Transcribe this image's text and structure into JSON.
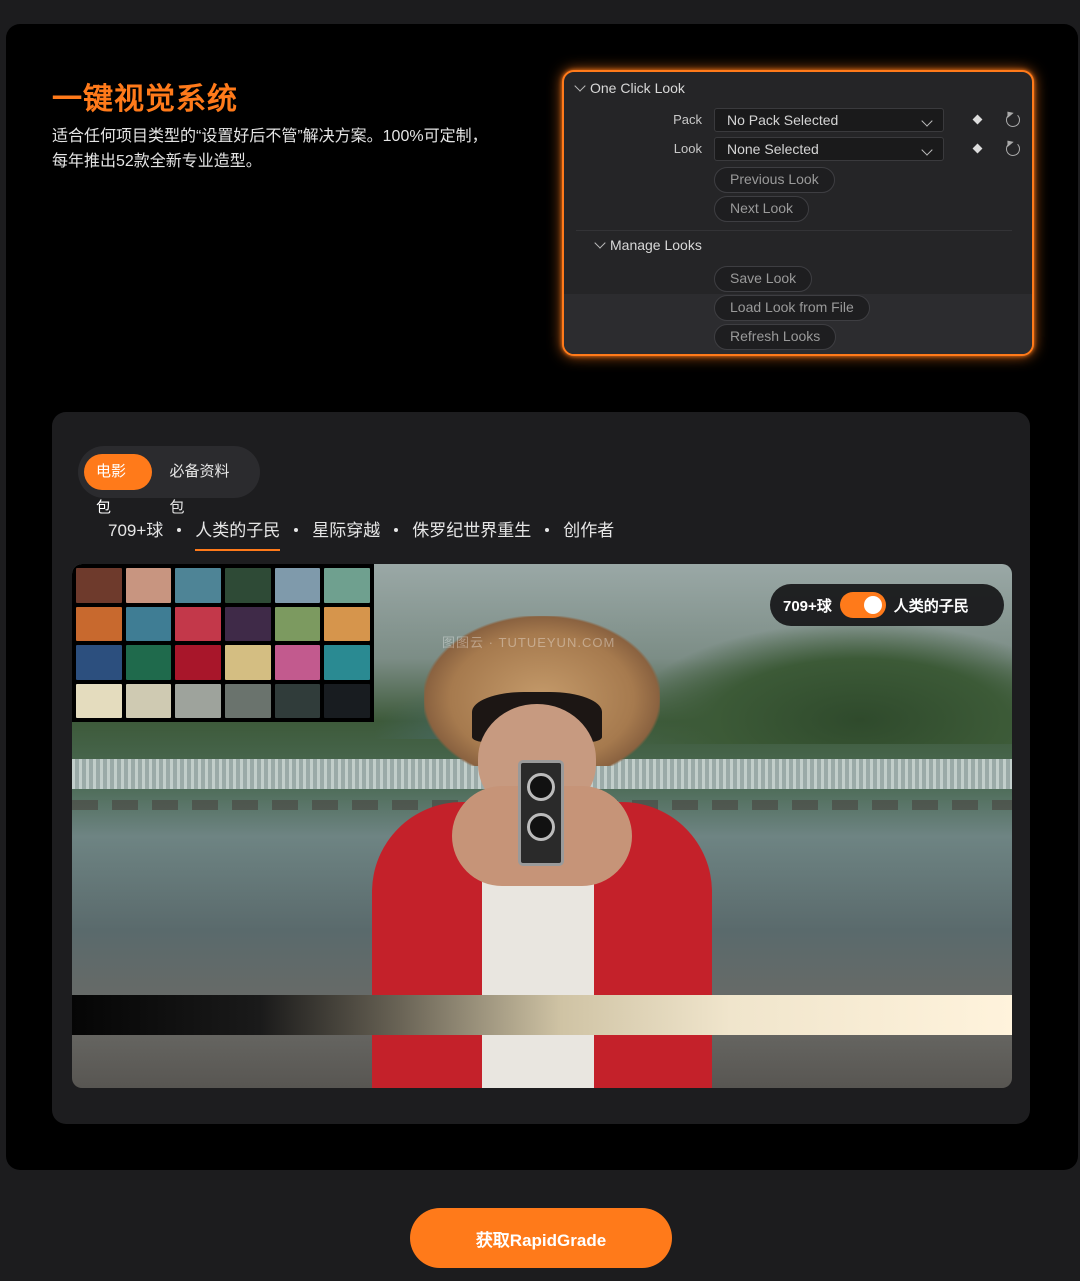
{
  "hero": {
    "title": "一键视觉系统",
    "subtitle_line1": "适合任何项目类型的“设置好后不管”解决方案。100%可定制，",
    "subtitle_line2": "每年推出52款全新专业造型。"
  },
  "panel": {
    "section_title": "One Click Look",
    "pack_label": "Pack",
    "pack_value": "No Pack Selected",
    "look_label": "Look",
    "look_value": "None Selected",
    "previous_look": "Previous Look",
    "next_look": "Next Look",
    "manage_title": "Manage Looks",
    "save_look": "Save Look",
    "load_look": "Load Look from File",
    "refresh_looks": "Refresh Looks"
  },
  "card": {
    "tabs": [
      "电影包",
      "必备资料包"
    ],
    "active_tab": 0,
    "looks": [
      "709+球",
      "人类的子民",
      "星际穿越",
      "侏罗纪世界重生",
      "创作者"
    ],
    "active_look": 1
  },
  "preview": {
    "compare_left": "709+球",
    "compare_right": "人类的子民",
    "toggle_on": true,
    "watermark": "图图云 · TUTUEYUN.COM",
    "checker_colors": [
      "#6e3a2c",
      "#c89580",
      "#4e8496",
      "#2e4a36",
      "#7f9aab",
      "#6fa08f",
      "#c8692e",
      "#3f7d94",
      "#c3384a",
      "#3f2a48",
      "#7c9a60",
      "#d6954c",
      "#2c4f7e",
      "#1f6a4c",
      "#a8162a",
      "#d4be82",
      "#c25a8e",
      "#2a8a92",
      "#e4dcbe",
      "#cfcab2",
      "#9ea39c",
      "#6a736d",
      "#303c3a",
      "#181c20"
    ]
  },
  "cta": {
    "label": "获取RapidGrade"
  },
  "colors": {
    "accent": "#ff7a1a",
    "panel_bg": "#252527",
    "card_bg": "#1d1d1f"
  }
}
